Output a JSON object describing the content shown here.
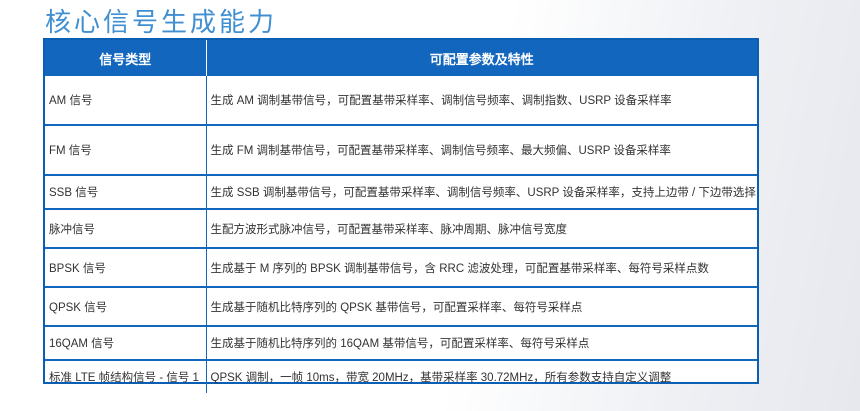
{
  "page": {
    "title": "核心信号生成能力"
  },
  "table": {
    "headers": [
      "信号类型",
      "可配置参数及特性"
    ],
    "rows": [
      {
        "type": "AM 信号",
        "desc": "生成 AM 调制基带信号，可配置基带采样率、调制信号频率、调制指数、USRP 设备采样率"
      },
      {
        "type": "FM 信号",
        "desc": "生成 FM 调制基带信号，可配置基带采样率、调制信号频率、最大频偏、USRP 设备采样率"
      },
      {
        "type": "SSB 信号",
        "desc": "生成 SSB 调制基带信号，可配置基带采样率、调制信号频率、USRP 设备采样率，支持上边带 / 下边带选择"
      },
      {
        "type": "脉冲信号",
        "desc": "生配方波形式脉冲信号，可配置基带采样率、脉冲周期、脉冲信号宽度"
      },
      {
        "type": "BPSK 信号",
        "desc": "生成基于 M 序列的 BPSK 调制基带信号，含 RRC 滤波处理，可配置基带采样率、每符号采样点数"
      },
      {
        "type": "QPSK 信号",
        "desc": "生成基于随机比特序列的 QPSK 基带信号，可配置采样率、每符号采样点"
      },
      {
        "type": "16QAM 信号",
        "desc": "生成基于随机比特序列的 16QAM 基带信号，可配置采样率、每符号采样点"
      },
      {
        "type": "标准 LTE 帧结构信号 - 信号 1",
        "desc": "QPSK 调制，一帧 10ms，带宽 20MHz，基带采样率 30.72MHz，所有参数支持自定义调整"
      }
    ]
  }
}
